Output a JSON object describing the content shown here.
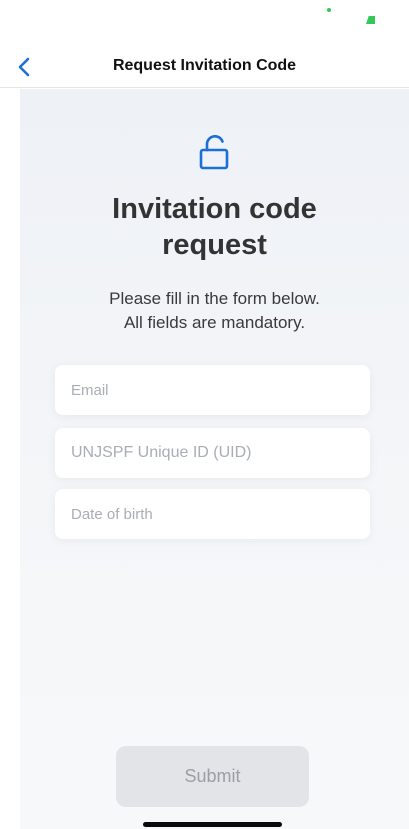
{
  "navigation": {
    "title": "Request Invitation Code",
    "back_icon": "chevron-left-icon"
  },
  "header": {
    "icon": "unlock-icon",
    "title": "Invitation code request",
    "instructions_line1": "Please fill in the form below.",
    "instructions_line2": "All fields are mandatory."
  },
  "form": {
    "email_placeholder": "Email",
    "email_value": "",
    "uid_placeholder": "UNJSPF Unique ID (UID)",
    "uid_value": "",
    "dob_placeholder": "Date of birth",
    "dob_value": ""
  },
  "submit": {
    "label": "Submit"
  },
  "colors": {
    "accent": "#1d6fd8",
    "submit_bg": "#e2e4e8",
    "submit_text": "#9a9ea6",
    "status_green": "#34c759"
  }
}
